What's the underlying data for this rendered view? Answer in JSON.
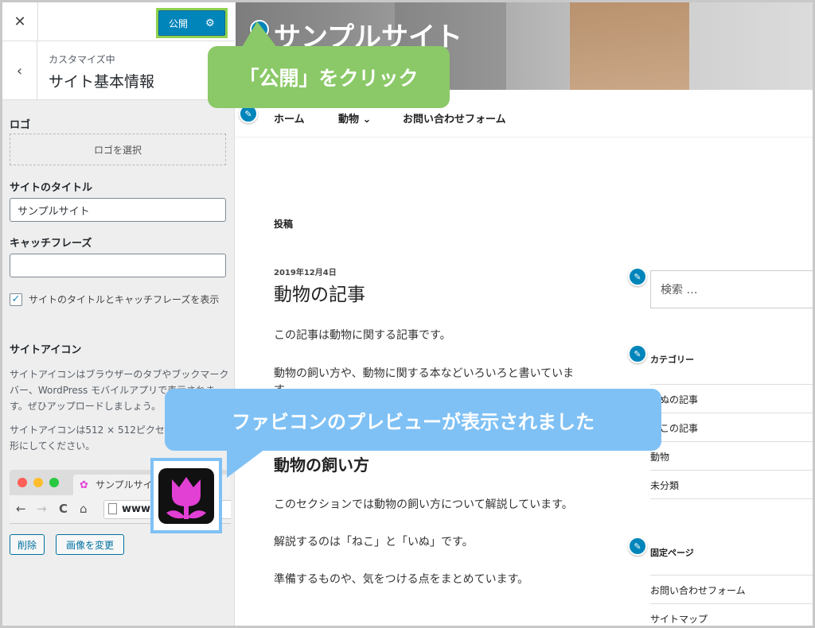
{
  "sidebar": {
    "close_glyph": "✕",
    "publish_label": "公開",
    "publish_gear": "⚙",
    "back_glyph": "‹",
    "crumb": "カスタマイズ中",
    "section_title": "サイト基本情報",
    "logo_label": "ロゴ",
    "logo_select": "ロゴを選択",
    "site_title_label": "サイトのタイトル",
    "site_title_value": "サンプルサイト",
    "tagline_label": "キャッチフレーズ",
    "tagline_value": "",
    "display_checkbox_checked": true,
    "check_glyph": "✓",
    "display_checkbox_text": "サイトのタイトルとキャッチフレーズを表示",
    "site_icon_label": "サイトアイコン",
    "site_icon_desc1": "サイトアイコンはブラウザーのタブやブックマークバー、WordPress モバイルアプリで表示されます。ぜひアップロードしましょう。",
    "site_icon_desc2": "サイトアイコンは512 × 512ピクセル以上の正方形にしてください。",
    "browser_tab_text": "サンプルサイト",
    "browser_tab_icon": "✿",
    "nav_back": "←",
    "nav_forward": "→",
    "nav_reload": "C",
    "nav_home": "⌂",
    "browser_url": "www.",
    "remove_button": "削除",
    "change_button": "画像を変更",
    "favicon_color": "#e23fd5"
  },
  "preview": {
    "site_title": "サンプルサイト",
    "pen_glyph": "✎",
    "nav": [
      "ホーム",
      "動物 ⌄",
      "お問い合わせフォーム"
    ],
    "section_label": "投稿",
    "post_date": "2019年12月4日",
    "post_title": "動物の記事",
    "paragraphs": [
      "この記事は動物に関する記事です。",
      "動物の飼い方や、動物に関する本などいろいろと書いていま",
      "す。"
    ],
    "heading2": "動物の飼い方",
    "paragraphs2": [
      "このセクションでは動物の飼い方について解説しています。",
      "解説するのは「ねこ」と「いぬ」です。",
      "準備するものや、気をつける点をまとめています。"
    ],
    "search_placeholder": "検索 …",
    "categories_title": "カテゴリー",
    "categories": [
      "いぬの記事",
      "ねこの記事",
      "動物",
      "未分類"
    ],
    "pages_title": "固定ページ",
    "pages": [
      "お問い合わせフォーム",
      "サイトマップ"
    ]
  },
  "annotations": {
    "green_callout": "「公開」をクリック",
    "blue_callout": "ファビコンのプレビューが表示されました",
    "green_color": "#8bc968",
    "blue_color": "#7fc1f5"
  }
}
